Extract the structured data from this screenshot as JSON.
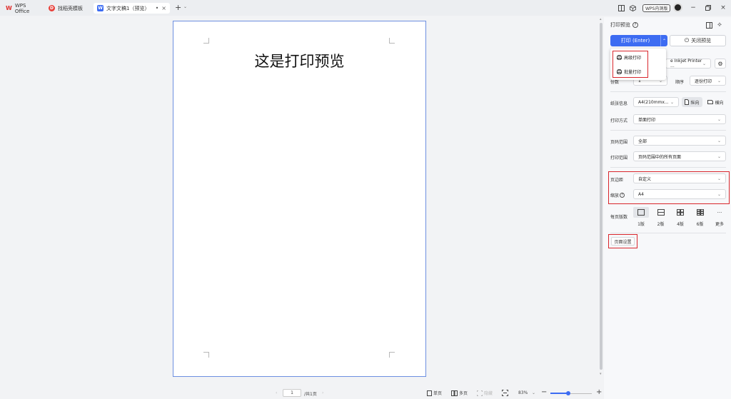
{
  "tabs": [
    {
      "label": "WPS Office",
      "icon": "wps-logo-icon"
    },
    {
      "label": "找稻壳模板",
      "icon": "docer-logo-icon"
    },
    {
      "label": "文字文稿1（预览）",
      "icon": "writer-doc-icon",
      "active": true
    }
  ],
  "titlebar": {
    "wps_badge": "WPS内测版",
    "new_tab": "+"
  },
  "document": {
    "title": "这是打印预览"
  },
  "statusbar": {
    "page_input": "1",
    "page_total": "/共1页",
    "single_page": "单页",
    "multi_page": "多页",
    "hide_page": "隐藏",
    "zoom": "83%",
    "zoom_minus": "−",
    "zoom_plus": "+"
  },
  "panel": {
    "title": "打印预览",
    "print_button": "打印 (Enter)",
    "close_preview": "关闭预览",
    "print_menu": [
      "高级打印",
      "批量打印"
    ],
    "printer_value": "e Inkjet Printer ...",
    "copies_label": "份数",
    "copies_value": "1",
    "order_label": "顺序",
    "order_value": "逐份打印",
    "paper_label": "纸张信息",
    "paper_value": "A4(210mmx...",
    "portrait": "纵向",
    "landscape": "横向",
    "method_label": "打印方式",
    "method_value": "单面打印",
    "range_label": "页码范围",
    "range_value": "全部",
    "scope_label": "打印范围",
    "scope_value": "页码范围中的所有页面",
    "margin_label": "页边距",
    "margin_value": "自定义",
    "scale_label": "缩放",
    "scale_value": "A4",
    "per_sheet_label": "每页版数",
    "per_sheet_options": [
      "1版",
      "2版",
      "4版",
      "6版",
      "更多"
    ],
    "page_setup": "页面设置"
  },
  "colors": {
    "accent": "#3d6cf2",
    "highlight": "#d9262c",
    "page_border": "#6d8fe0"
  }
}
